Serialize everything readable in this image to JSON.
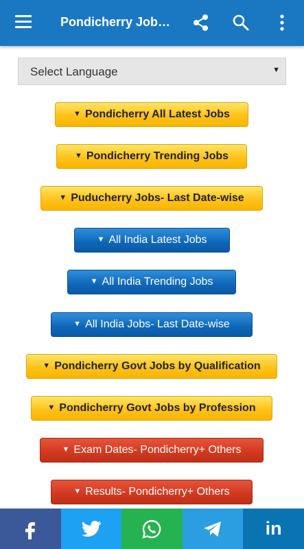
{
  "appbar": {
    "title": "Pondicherry Job Al..."
  },
  "language_select": {
    "label": "Select Language",
    "caret": "▼"
  },
  "buttons": [
    {
      "label": "Pondicherry All Latest Jobs",
      "style": "yellow"
    },
    {
      "label": "Pondicherry Trending Jobs",
      "style": "yellow"
    },
    {
      "label": "Puducherry Jobs- Last Date-wise",
      "style": "yellow"
    },
    {
      "label": "All India Latest Jobs",
      "style": "blue"
    },
    {
      "label": "All India Trending Jobs",
      "style": "blue"
    },
    {
      "label": "All India Jobs- Last Date-wise",
      "style": "blue"
    },
    {
      "label": "Pondicherry Govt Jobs by Qualification",
      "style": "yellow"
    },
    {
      "label": "Pondicherry Govt Jobs by Profession",
      "style": "yellow"
    },
    {
      "label": "Exam Dates- Pondicherry+ Others",
      "style": "red"
    },
    {
      "label": "Results- Pondicherry+ Others",
      "style": "red"
    }
  ],
  "button_triangle": "▼",
  "share_bar": {
    "facebook_icon": "facebook-icon",
    "twitter_icon": "twitter-icon",
    "whatsapp_icon": "whatsapp-icon",
    "telegram_icon": "telegram-icon",
    "linkedin_icon": "linkedin-icon",
    "linkedin_text": "in",
    "facebook_text": "f"
  },
  "colors": {
    "appbar": "#1a78c2",
    "facebook": "#3b5998",
    "twitter": "#1da1f2",
    "whatsapp": "#25b250",
    "telegram": "#2a9ee0",
    "linkedin": "#0a73b1"
  }
}
